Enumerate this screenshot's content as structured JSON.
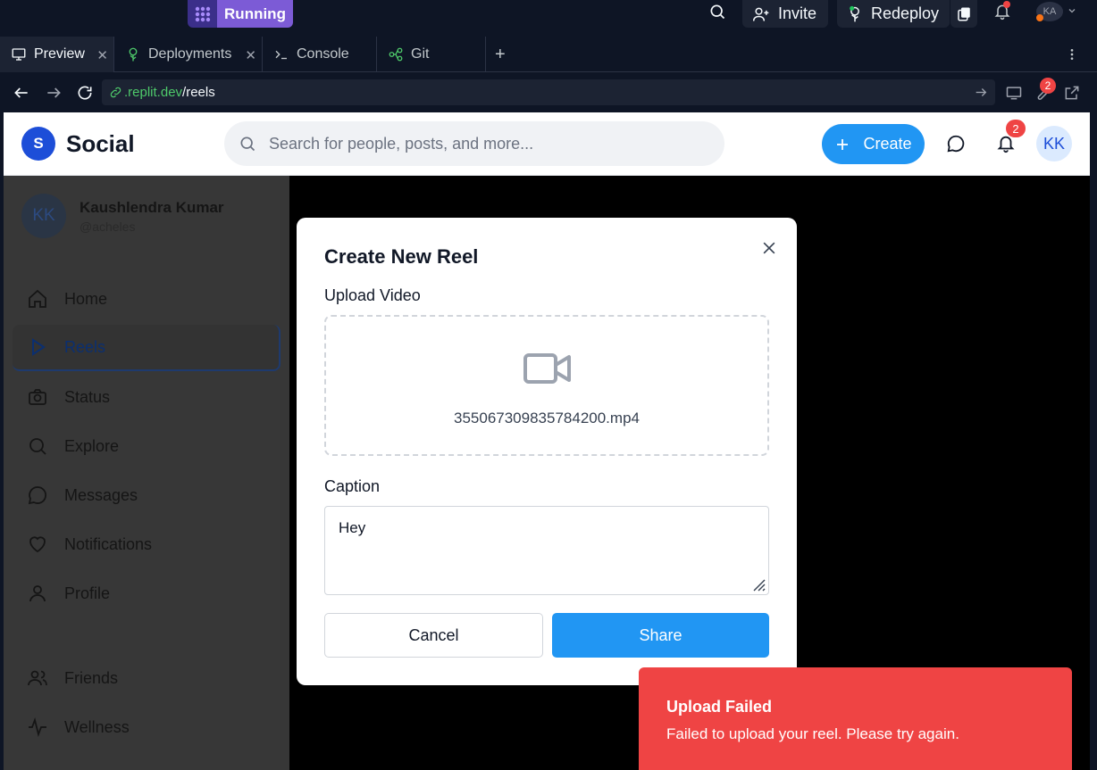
{
  "replit": {
    "run_label": "Running",
    "invite_label": "Invite",
    "redeploy_label": "Redeploy",
    "avatar_initials": "KA"
  },
  "tabs": [
    {
      "label": "Preview",
      "active": true
    },
    {
      "label": "Deployments",
      "active": false
    },
    {
      "label": "Console",
      "active": false
    },
    {
      "label": "Git",
      "active": false
    }
  ],
  "urlbar": {
    "host": ".replit.dev",
    "path": "/reels",
    "devtools_badge": "2"
  },
  "header": {
    "logo_letter": "S",
    "brand": "Social",
    "search_placeholder": "Search for people, posts, and more...",
    "create_label": "Create",
    "notifications_count": "2",
    "avatar_initials": "KK"
  },
  "sidebar": {
    "user": {
      "initials": "KK",
      "name": "Kaushlendra Kumar",
      "handle": "@acheles"
    },
    "items": [
      {
        "label": "Home",
        "icon": "home-icon"
      },
      {
        "label": "Reels",
        "icon": "play-icon",
        "active": true
      },
      {
        "label": "Status",
        "icon": "camera-icon"
      },
      {
        "label": "Explore",
        "icon": "search-icon"
      },
      {
        "label": "Messages",
        "icon": "message-icon"
      },
      {
        "label": "Notifications",
        "icon": "heart-icon"
      },
      {
        "label": "Profile",
        "icon": "user-icon"
      },
      {
        "label": "Friends",
        "icon": "users-icon"
      },
      {
        "label": "Wellness",
        "icon": "activity-icon"
      }
    ]
  },
  "modal": {
    "title": "Create New Reel",
    "upload_label": "Upload Video",
    "file_name": "355067309835784200.mp4",
    "caption_label": "Caption",
    "caption_value": "Hey",
    "cancel_label": "Cancel",
    "share_label": "Share"
  },
  "toast": {
    "title": "Upload Failed",
    "message": "Failed to upload your reel. Please try again."
  },
  "colors": {
    "primary": "#2196f3",
    "error": "#ef4444",
    "replit_bg": "#0e1525",
    "running": "#7c5bd6"
  }
}
